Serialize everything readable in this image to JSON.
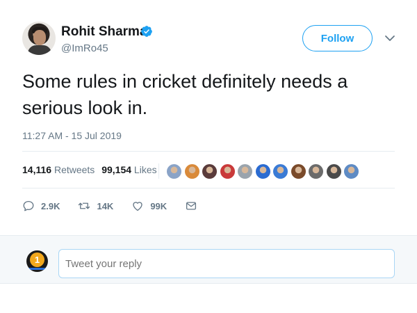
{
  "author": {
    "name": "Rohit Sharma",
    "handle": "@ImRo45",
    "verified": true
  },
  "header": {
    "follow_label": "Follow"
  },
  "tweet": {
    "text": "Some rules in cricket definitely needs a serious look in.",
    "timestamp": "11:27 AM - 15 Jul 2019"
  },
  "stats": {
    "retweets_count": "14,116",
    "retweets_label": "Retweets",
    "likes_count": "99,154",
    "likes_label": "Likes"
  },
  "likers": [
    {
      "color": "#8aa3c7"
    },
    {
      "color": "#d98a3a"
    },
    {
      "color": "#5a3b3b"
    },
    {
      "color": "#c93a3a"
    },
    {
      "color": "#9aa4ad"
    },
    {
      "color": "#2a6bd1"
    },
    {
      "color": "#3a7bd5"
    },
    {
      "color": "#7a4a2a"
    },
    {
      "color": "#6b6b6b"
    },
    {
      "color": "#4a4a4a"
    },
    {
      "color": "#5e8bc4"
    }
  ],
  "actions": {
    "replies": "2.9K",
    "retweets": "14K",
    "likes": "99K"
  },
  "reply": {
    "placeholder": "Tweet your reply",
    "avatar_badge": "1"
  },
  "colors": {
    "accent": "#1da1f2",
    "muted": "#657786",
    "text": "#14171a",
    "divider": "#e6ecf0"
  }
}
